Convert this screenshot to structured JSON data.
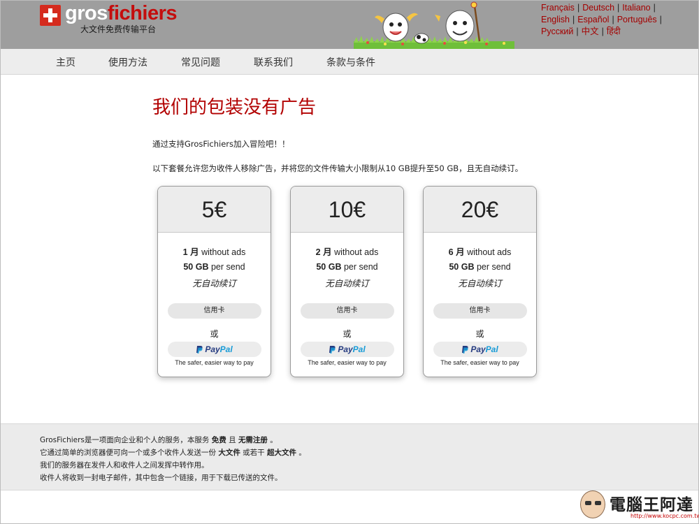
{
  "header": {
    "logo_gros": "gros",
    "logo_fichiers": "fichiers",
    "logo_subtitle": "大文件免费传输平台",
    "languages_row1": [
      "Français",
      "Deutsch",
      "Italiano"
    ],
    "languages_row2": [
      "English",
      "Español",
      "Português"
    ],
    "languages_row3": [
      "Русский",
      "中文",
      "हिंदी"
    ],
    "separator": "|"
  },
  "nav": {
    "items": [
      "主页",
      "使用方法",
      "常见问题",
      "联系我们",
      "条款与条件"
    ]
  },
  "main": {
    "title": "我们的包装没有广告",
    "intro1": "通过支持GrosFichiers加入冒险吧！！",
    "intro2": "以下套餐允许您为收件人移除广告，并将您的文件传输大小限制从10 GB提升至50 GB，且无自动续订。"
  },
  "plans": [
    {
      "price": "5€",
      "duration": "1 月",
      "without_ads": "without ads",
      "size": "50 GB",
      "per_send": "per send",
      "renewal": "无自动续订"
    },
    {
      "price": "10€",
      "duration": "2 月",
      "without_ads": "without ads",
      "size": "50 GB",
      "per_send": "per send",
      "renewal": "无自动续订"
    },
    {
      "price": "20€",
      "duration": "6 月",
      "without_ads": "without ads",
      "size": "50 GB",
      "per_send": "per send",
      "renewal": "无自动续订"
    }
  ],
  "payment": {
    "card_label": "信用卡",
    "or_label": "或",
    "paypal_pay": "Pay",
    "paypal_pal": "Pal",
    "paypal_tagline": "The safer, easier way to pay"
  },
  "footer": {
    "line1_a": "GrosFichiers是一项面向企业和个人的服务，本服务 ",
    "line1_b": "免费",
    "line1_c": " 且 ",
    "line1_d": "无需注册",
    "line1_e": " 。",
    "line2_a": "它通过简单的浏览器便可向一个或多个收件人发送一份 ",
    "line2_b": "大文件",
    "line2_c": " 或若干 ",
    "line2_d": "超大文件",
    "line2_e": " 。",
    "line3": "我们的服务器在发件人和收件人之间发挥中转作用。",
    "line4": "收件人将收到一封电子邮件，其中包含一个链接，用于下载已传送的文件。"
  },
  "watermark": {
    "text": "電腦王阿達",
    "url": "http://www.kocpc.com.tw"
  },
  "colors": {
    "brand_red": "#c40d0d",
    "header_gray": "#9e9e9e",
    "link_red": "#a40000",
    "paypal_dark": "#253b80",
    "paypal_light": "#179bd7"
  }
}
